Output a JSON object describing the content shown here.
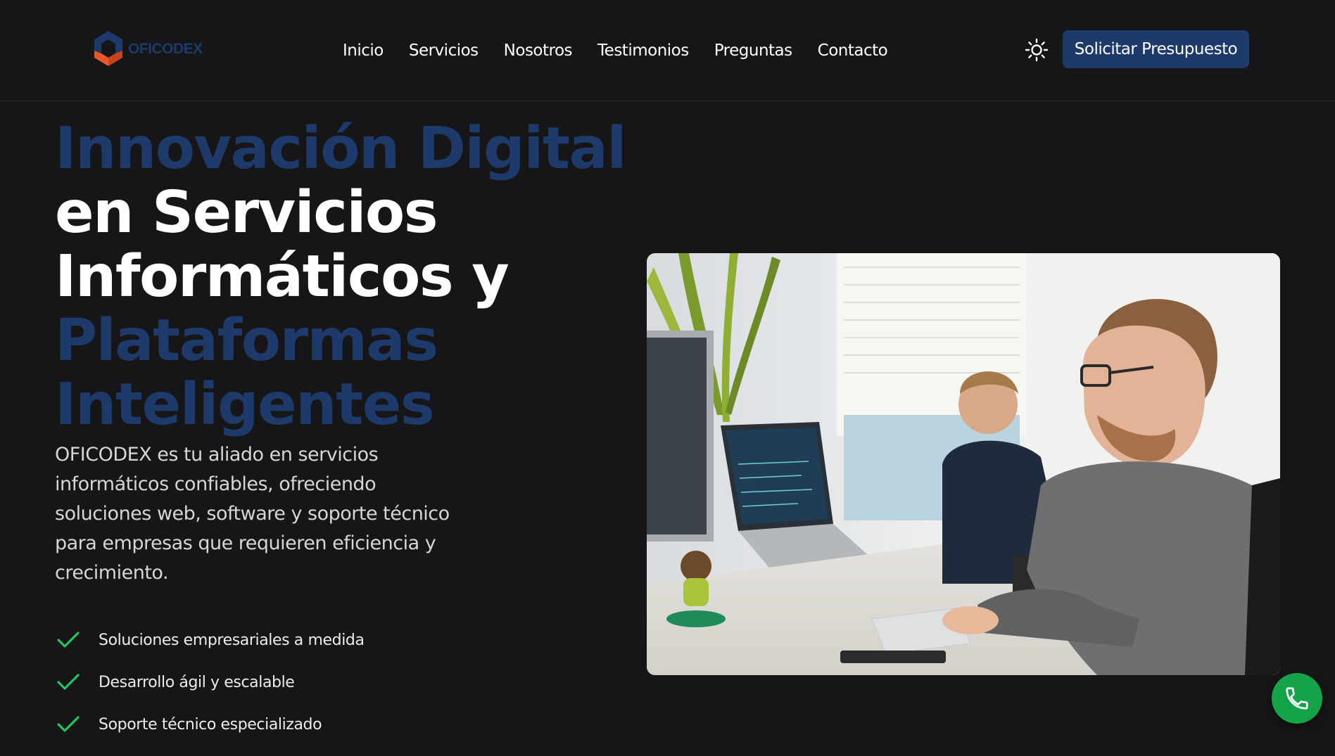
{
  "brand": {
    "name": "OFICODEX",
    "logo_icon": "hexagon-logo-icon",
    "primary_color": "#1d3a6b",
    "accent_color": "#e8562a"
  },
  "nav": {
    "items": [
      {
        "label": "Inicio"
      },
      {
        "label": "Servicios"
      },
      {
        "label": "Nosotros"
      },
      {
        "label": "Testimonios"
      },
      {
        "label": "Preguntas"
      },
      {
        "label": "Contacto"
      }
    ],
    "theme_icon": "sun-icon",
    "cta_label": "Solicitar Presupuesto"
  },
  "hero": {
    "title_lines": [
      "Innovación Digital",
      "en Servicios",
      "Informáticos y",
      "Plataformas",
      "Inteligentes"
    ],
    "description": "OFICODEX es tu aliado en servicios informáticos confiables, ofreciendo soluciones web, software y soporte técnico para empresas que requieren eficiencia y crecimiento.",
    "features": [
      {
        "label": "Soluciones empresariales a medida",
        "icon": "check-icon"
      },
      {
        "label": "Desarrollo ágil y escalable",
        "icon": "check-icon"
      },
      {
        "label": "Soporte técnico especializado",
        "icon": "check-icon"
      }
    ],
    "image": "office-developers-photo",
    "check_color": "#22c55e"
  },
  "floating": {
    "phone_icon": "phone-icon",
    "phone_color": "#15a34a"
  }
}
